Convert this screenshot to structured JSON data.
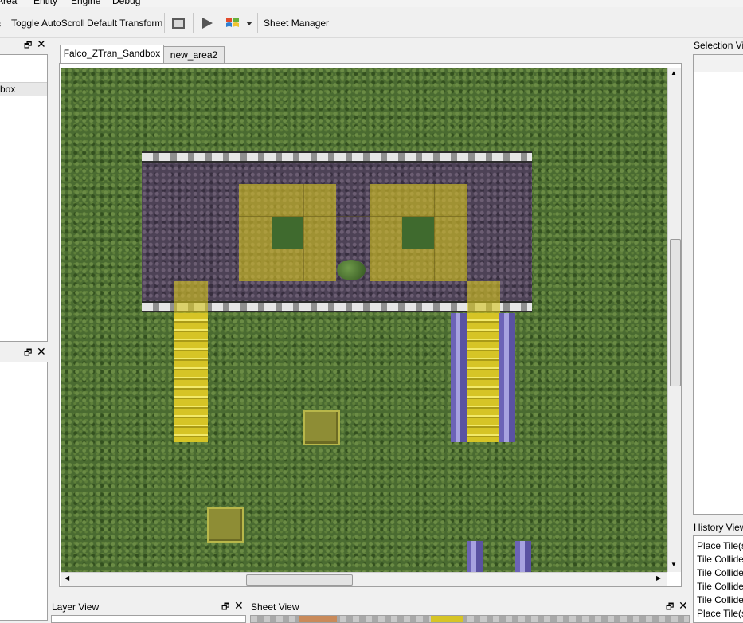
{
  "menu": [
    "Area",
    "Entity",
    "Engine",
    "Debug"
  ],
  "toolbar": {
    "toggle_autoscroll": "Toggle AutoScroll",
    "default_transform": "Default Transform",
    "sheet_manager": "Sheet Manager"
  },
  "left_dock_1": {
    "item": "box"
  },
  "tabs": [
    "Falco_ZTran_Sandbox",
    "new_area2"
  ],
  "docks": {
    "selection_view": "Selection View",
    "history_view": "History View",
    "layer_view": "Layer View",
    "sheet_view": "Sheet View"
  },
  "history": [
    "Place Tile(s",
    "Tile Collide",
    "Tile Collide",
    "Tile Collide",
    "Tile Collide",
    "Place Tile(s"
  ],
  "icons": {
    "close": "close-icon",
    "float": "float-icon",
    "play": "play-icon",
    "windows": "windows-flag-icon",
    "dropdown": "chevron-down-icon",
    "window": "window-icon"
  },
  "colors": {
    "grass": "#4a6b31",
    "floor": "#4d4256",
    "highlight": "#d3c41e",
    "pillar": "#6c63b7"
  }
}
